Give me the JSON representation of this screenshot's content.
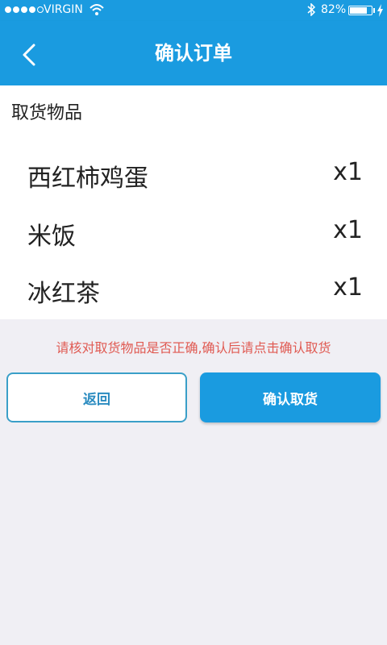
{
  "status_bar": {
    "carrier": "VIRGIN",
    "battery": "82%",
    "battery_level": 0.82,
    "signal_bars": 4,
    "signal_total": 5
  },
  "navbar": {
    "title": "确认订单",
    "back_icon": "chevron-left-icon"
  },
  "items_section": {
    "title": "取货物品",
    "items": [
      {
        "name": "西红柿鸡蛋",
        "qty": "x1"
      },
      {
        "name": "米饭",
        "qty": "x1"
      },
      {
        "name": "冰红茶",
        "qty": "x1"
      }
    ]
  },
  "notice": "请核对取货物品是否正确,确认后请点击确认取货",
  "buttons": {
    "back_label": "返回",
    "confirm_label": "确认取货"
  },
  "colors": {
    "primary": "#1a9be0",
    "notice": "#e05a52",
    "background": "#f0eff4"
  }
}
